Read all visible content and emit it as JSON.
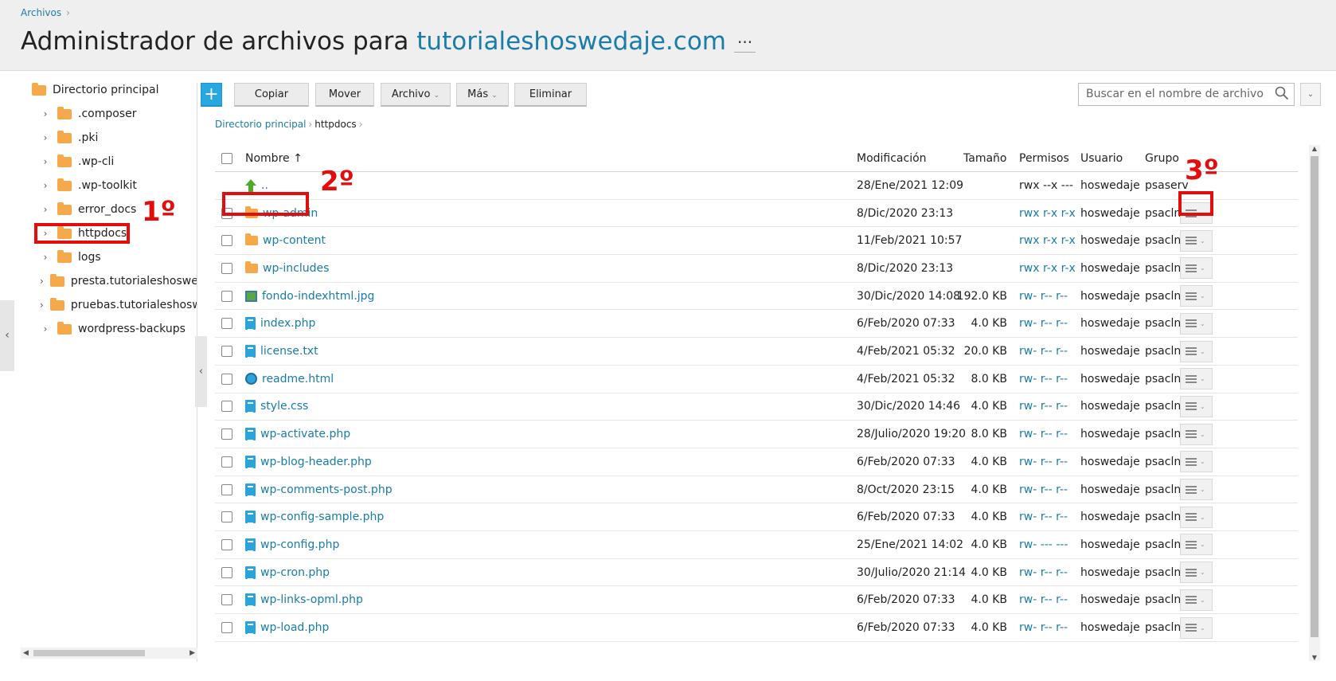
{
  "header": {
    "breadcrumb": "Archivos",
    "title_prefix": "Administrador de archivos para ",
    "title_domain": "tutorialeshoswedaje.com",
    "more": "···"
  },
  "sidebar": {
    "root": "Directorio principal",
    "items": [
      ".composer",
      ".pki",
      ".wp-cli",
      ".wp-toolkit",
      "error_docs",
      "httpdocs",
      "logs",
      "presta.tutorialeshoswedaje.com",
      "pruebas.tutorialeshoswedaje.com",
      "wordpress-backups"
    ]
  },
  "toolbar": {
    "add": "+",
    "copy": "Copiar",
    "move": "Mover",
    "file": "Archivo",
    "more": "Más",
    "delete": "Eliminar"
  },
  "search": {
    "placeholder": "Buscar en el nombre de archivo"
  },
  "path": {
    "root": "Directorio principal",
    "current": "httpdocs"
  },
  "columns": {
    "name": "Nombre ↑",
    "modified": "Modificación",
    "size": "Tamaño",
    "perms": "Permisos",
    "user": "Usuario",
    "group": "Grupo"
  },
  "rows": [
    {
      "name": "..",
      "icon": "up-icon",
      "modified": "28/Ene/2021 12:09",
      "size": "",
      "perms": "rwx --x ---",
      "user": "hoswedaje",
      "group": "psaserv"
    },
    {
      "name": "wp-admin",
      "icon": "folder-icon",
      "modified": "8/Dic/2020 23:13",
      "size": "",
      "perms": "rwx r-x r-x",
      "user": "hoswedaje",
      "group": "psacln"
    },
    {
      "name": "wp-content",
      "icon": "folder-icon",
      "modified": "11/Feb/2021 10:57",
      "size": "",
      "perms": "rwx r-x r-x",
      "user": "hoswedaje",
      "group": "psacln"
    },
    {
      "name": "wp-includes",
      "icon": "folder-icon",
      "modified": "8/Dic/2020 23:13",
      "size": "",
      "perms": "rwx r-x r-x",
      "user": "hoswedaje",
      "group": "psacln"
    },
    {
      "name": "fondo-indexhtml.jpg",
      "icon": "image-icon",
      "modified": "30/Dic/2020 14:08",
      "size": "192.0 KB",
      "perms": "rw- r-- r--",
      "user": "hoswedaje",
      "group": "psacln"
    },
    {
      "name": "index.php",
      "icon": "file-icon",
      "modified": "6/Feb/2020 07:33",
      "size": "4.0 KB",
      "perms": "rw- r-- r--",
      "user": "hoswedaje",
      "group": "psacln"
    },
    {
      "name": "license.txt",
      "icon": "file-icon",
      "modified": "4/Feb/2021 05:32",
      "size": "20.0 KB",
      "perms": "rw- r-- r--",
      "user": "hoswedaje",
      "group": "psacln"
    },
    {
      "name": "readme.html",
      "icon": "web-icon",
      "modified": "4/Feb/2021 05:32",
      "size": "8.0 KB",
      "perms": "rw- r-- r--",
      "user": "hoswedaje",
      "group": "psacln"
    },
    {
      "name": "style.css",
      "icon": "file-icon",
      "modified": "30/Dic/2020 14:46",
      "size": "4.0 KB",
      "perms": "rw- r-- r--",
      "user": "hoswedaje",
      "group": "psacln"
    },
    {
      "name": "wp-activate.php",
      "icon": "file-icon",
      "modified": "28/Julio/2020 19:20",
      "size": "8.0 KB",
      "perms": "rw- r-- r--",
      "user": "hoswedaje",
      "group": "psacln"
    },
    {
      "name": "wp-blog-header.php",
      "icon": "file-icon",
      "modified": "6/Feb/2020 07:33",
      "size": "4.0 KB",
      "perms": "rw- r-- r--",
      "user": "hoswedaje",
      "group": "psacln"
    },
    {
      "name": "wp-comments-post.php",
      "icon": "file-icon",
      "modified": "8/Oct/2020 23:15",
      "size": "4.0 KB",
      "perms": "rw- r-- r--",
      "user": "hoswedaje",
      "group": "psacln"
    },
    {
      "name": "wp-config-sample.php",
      "icon": "file-icon",
      "modified": "6/Feb/2020 07:33",
      "size": "4.0 KB",
      "perms": "rw- r-- r--",
      "user": "hoswedaje",
      "group": "psacln"
    },
    {
      "name": "wp-config.php",
      "icon": "file-icon",
      "modified": "25/Ene/2021 14:02",
      "size": "4.0 KB",
      "perms": "rw- --- ---",
      "user": "hoswedaje",
      "group": "psacln"
    },
    {
      "name": "wp-cron.php",
      "icon": "file-icon",
      "modified": "30/Julio/2020 21:14",
      "size": "4.0 KB",
      "perms": "rw- r-- r--",
      "user": "hoswedaje",
      "group": "psacln"
    },
    {
      "name": "wp-links-opml.php",
      "icon": "file-icon",
      "modified": "6/Feb/2020 07:33",
      "size": "4.0 KB",
      "perms": "rw- r-- r--",
      "user": "hoswedaje",
      "group": "psacln"
    },
    {
      "name": "wp-load.php",
      "icon": "file-icon",
      "modified": "6/Feb/2020 07:33",
      "size": "4.0 KB",
      "perms": "rw- r-- r--",
      "user": "hoswedaje",
      "group": "psacln"
    }
  ],
  "annotations": [
    "1º",
    "2º",
    "3º"
  ],
  "colors": {
    "link": "#1a7ca8",
    "folder": "#f5a94b",
    "annotation": "#e30d0d",
    "add_button": "#28a8e0"
  }
}
